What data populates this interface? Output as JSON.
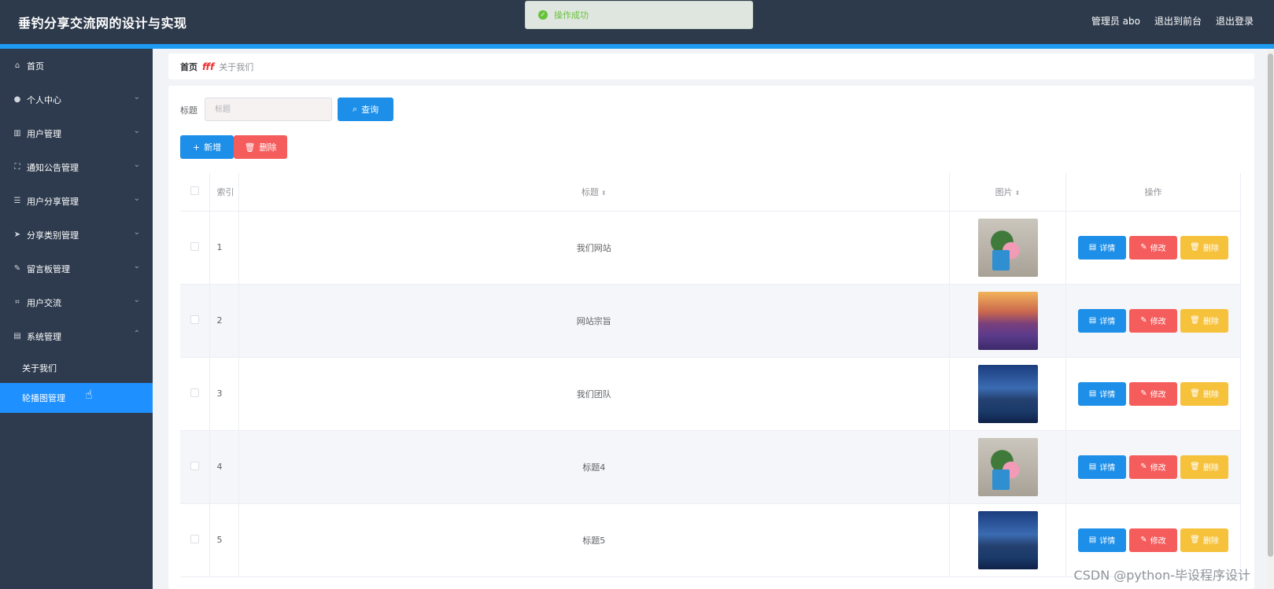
{
  "header": {
    "title": "垂钓分享交流网的设计与实现",
    "admin_label": "管理员 abo",
    "to_frontend": "退出到前台",
    "logout": "退出登录"
  },
  "toast": {
    "message": "操作成功"
  },
  "sidebar": {
    "items": [
      {
        "label": "首页",
        "icon": "home-icon",
        "has_children": false
      },
      {
        "label": "个人中心",
        "icon": "user-icon",
        "has_children": true
      },
      {
        "label": "用户管理",
        "icon": "bars-icon",
        "has_children": true
      },
      {
        "label": "通知公告管理",
        "icon": "frame-icon",
        "has_children": true
      },
      {
        "label": "用户分享管理",
        "icon": "sliders-icon",
        "has_children": true
      },
      {
        "label": "分享类别管理",
        "icon": "send-icon",
        "has_children": true
      },
      {
        "label": "留言板管理",
        "icon": "message-icon",
        "has_children": true
      },
      {
        "label": "用户交流",
        "icon": "crop-icon",
        "has_children": true
      },
      {
        "label": "系统管理",
        "icon": "chart-icon",
        "has_children": true,
        "expanded": true
      }
    ],
    "sub_items": [
      {
        "label": "关于我们",
        "active": false
      },
      {
        "label": "轮播图管理",
        "active": true
      }
    ]
  },
  "breadcrumb": {
    "home": "首页",
    "separator": "fff",
    "current": "关于我们"
  },
  "search": {
    "label": "标题",
    "placeholder": "标题",
    "query_button": "查询"
  },
  "actions": {
    "add_button": "新增",
    "delete_button": "删除"
  },
  "table": {
    "headers": {
      "index": "索引",
      "title": "标题",
      "image": "图片",
      "ops": "操作"
    },
    "rows": [
      {
        "index": "1",
        "title": "我们网站",
        "image": "flower-vase"
      },
      {
        "index": "2",
        "title": "网站宗旨",
        "image": "lavender-field"
      },
      {
        "index": "3",
        "title": "我们团队",
        "image": "mountain-lake"
      },
      {
        "index": "4",
        "title": "标题4",
        "image": "flower-vase"
      },
      {
        "index": "5",
        "title": "标题5",
        "image": "mountain-lake"
      }
    ],
    "row_ops": {
      "detail": "详情",
      "edit": "修改",
      "delete": "删除"
    }
  },
  "watermark": "CSDN @python-毕设程序设计",
  "colors": {
    "header_bg": "#2d3a4b",
    "accent": "#1d8fe8",
    "danger": "#f55d5d",
    "warning": "#f6c23c",
    "success": "#67c23a"
  }
}
